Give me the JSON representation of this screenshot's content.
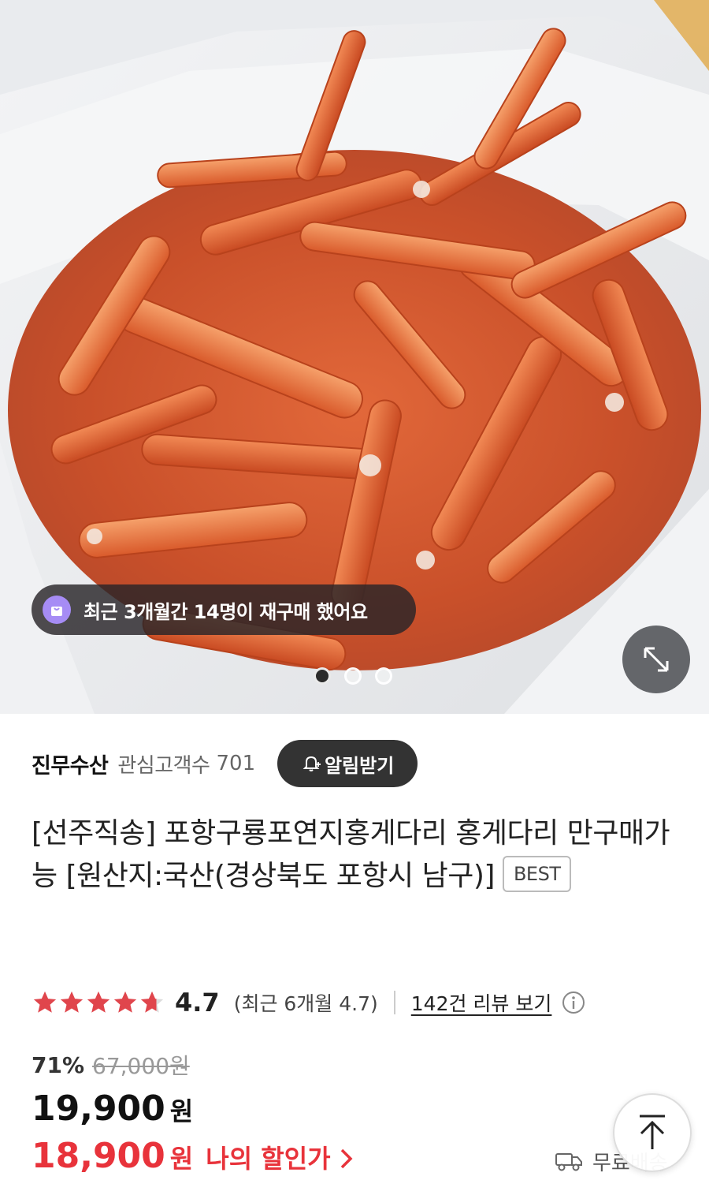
{
  "hero": {
    "image_alt": "red snow crab legs in a styrofoam box",
    "repurchase_text": "최근 3개월간 14명이 재구매 했어요",
    "slides": 3,
    "active_slide": 1
  },
  "seller": {
    "name": "진무수산",
    "follow_label": "관심고객수",
    "follow_count": "701",
    "alarm_button": "알림받기"
  },
  "product": {
    "title": "[선주직송] 포항구룡포연지홍게다리 홍게다리 만구매가능 [원산지:국산(경상북도 포항시 남구)]",
    "badge": "BEST"
  },
  "rating": {
    "score": "4.7",
    "recent": "(최근 6개월 4.7)",
    "review_link": "142건 리뷰 보기",
    "stars": 4.7
  },
  "price": {
    "discount_rate": "71%",
    "original": "67,000원",
    "sale": "19,900",
    "unit": "원",
    "my_price": "18,900",
    "my_unit": "원",
    "my_label": "나의 할인가"
  },
  "delivery": {
    "text": "무료배송"
  },
  "colors": {
    "accent_red": "#e8333b",
    "star_red": "#e0454c",
    "dark_button": "#333333",
    "badge_purple": "#a68cf5"
  }
}
